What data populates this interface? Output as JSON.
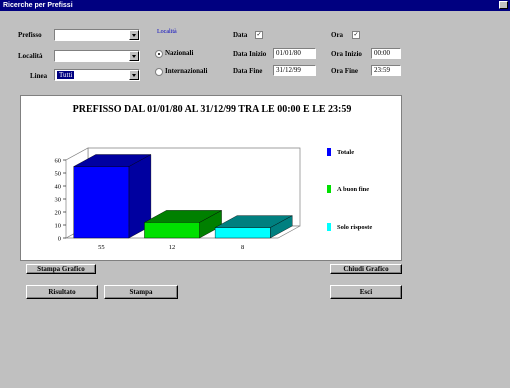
{
  "window": {
    "title": "Ricerche per Prefissi"
  },
  "filters": {
    "prefisso_label": "Prefisso",
    "prefisso_value": "",
    "localita_label": "Località",
    "localita_value": "",
    "linea_label": "Linea",
    "linea_value": "Tutti"
  },
  "localita_group": {
    "title": "Località",
    "options": [
      "Nazionali",
      "Internazionali"
    ],
    "selected": "Nazionali"
  },
  "data_section": {
    "data_label": "Data",
    "data_checked": true,
    "data_inizio_label": "Data Inizio",
    "data_inizio_value": "01/01/80",
    "data_fine_label": "Data Fine",
    "data_fine_value": "31/12/99"
  },
  "ora_section": {
    "ora_label": "Ora",
    "ora_checked": true,
    "ora_inizio_label": "Ora Inizio",
    "ora_inizio_value": "00:00",
    "ora_fine_label": "Ora Fine",
    "ora_fine_value": "23:59"
  },
  "chart_data": {
    "type": "bar",
    "title": "PREFISSO DAL 01/01/80 AL 31/12/99 TRA LE 00:00 E LE 23:59",
    "categories": [
      "55",
      "12",
      "8"
    ],
    "values": [
      55,
      12,
      8
    ],
    "colors": [
      "#0000ff",
      "#00e000",
      "#00ffff"
    ],
    "top_colors": [
      "#0000a0",
      "#008000",
      "#008080"
    ],
    "ylim": [
      0,
      60
    ],
    "yticks": [
      "0",
      "10",
      "20",
      "30",
      "40",
      "50",
      "60"
    ],
    "legend": [
      "Totale",
      "A buon fine",
      "Solo risposte"
    ],
    "legend_position": "right",
    "grid": false
  },
  "buttons": {
    "stampa": "Stampa Grafico",
    "chiudi": "Chiudi Grafico",
    "risultato": "Risultato",
    "stampa2": "Stampa",
    "esci": "Esci"
  }
}
